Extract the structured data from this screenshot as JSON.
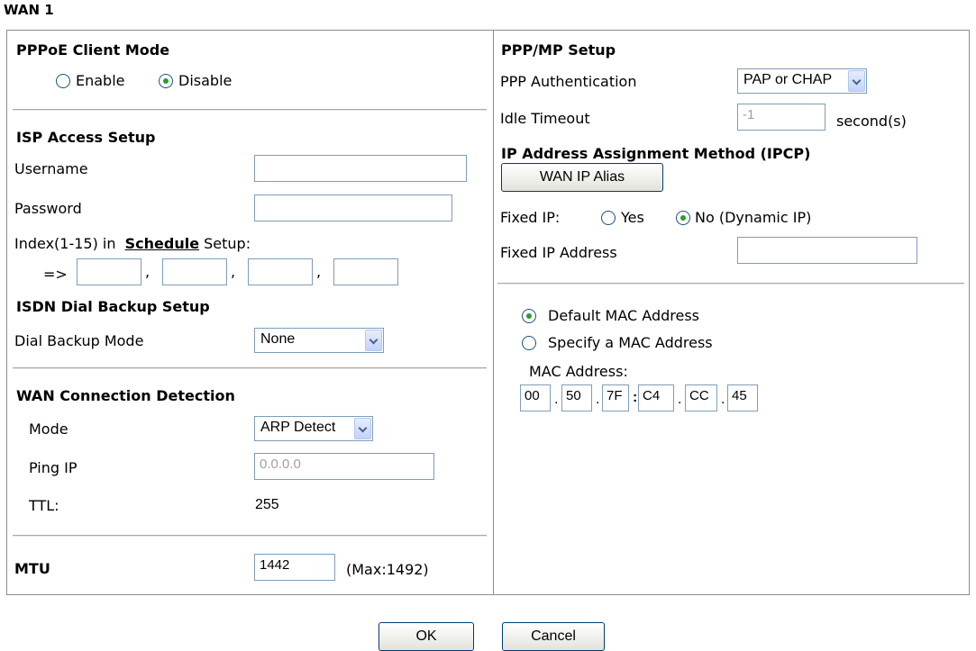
{
  "title": "WAN 1",
  "left": {
    "pppoe": {
      "heading": "PPPoE Client Mode",
      "enable_label": "Enable",
      "disable_label": "Disable",
      "selected": "Disable"
    },
    "isp": {
      "heading": "ISP Access Setup",
      "username_label": "Username",
      "username_value": "",
      "password_label": "Password",
      "password_value": "",
      "index_prefix": "Index(1-15) in",
      "schedule_link": "Schedule",
      "index_suffix": "Setup:",
      "arrow": "=>",
      "schedule_values": [
        "",
        "",
        "",
        ""
      ],
      "sep": ","
    },
    "isdn": {
      "heading": "ISDN Dial Backup Setup",
      "mode_label": "Dial Backup Mode",
      "mode_value": "None"
    },
    "detect": {
      "heading": "WAN Connection Detection",
      "mode_label": "Mode",
      "mode_value": "ARP Detect",
      "ping_label": "Ping IP",
      "ping_value": "0.0.0.0",
      "ttl_label": "TTL:",
      "ttl_value": "255"
    },
    "mtu": {
      "label": "MTU",
      "value": "1442",
      "hint": "(Max:1492)"
    }
  },
  "right": {
    "ppp": {
      "heading": "PPP/MP Setup",
      "auth_label": "PPP Authentication",
      "auth_value": "PAP or CHAP",
      "idle_label": "Idle Timeout",
      "idle_value": "-1",
      "idle_unit": "second(s)"
    },
    "ip": {
      "heading": "IP Address Assignment Method (IPCP)",
      "alias_button": "WAN IP Alias",
      "fixed_label": "Fixed IP:",
      "yes_label": "Yes",
      "no_label": "No (Dynamic IP)",
      "selected": "No",
      "fixed_addr_label": "Fixed IP Address",
      "fixed_addr_value": ""
    },
    "mac": {
      "default_label": "Default MAC Address",
      "specify_label": "Specify a MAC Address",
      "selected": "Default",
      "address_label": "MAC Address:",
      "octets": [
        "00",
        "50",
        "7F",
        "C4",
        "CC",
        "45"
      ],
      "seps": [
        ".",
        ".",
        ":",
        ".",
        "."
      ]
    }
  },
  "footer": {
    "ok": "OK",
    "cancel": "Cancel"
  }
}
